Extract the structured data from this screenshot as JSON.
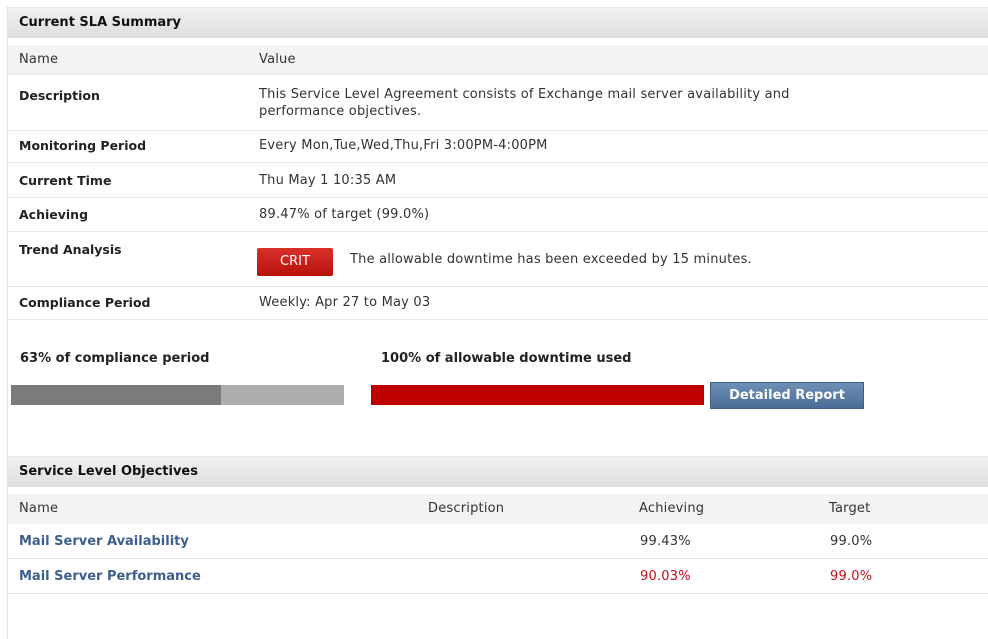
{
  "sla": {
    "title": "Current SLA Summary",
    "col_name": "Name",
    "col_value": "Value",
    "rows": [
      {
        "label": "Description",
        "value": "This Service Level Agreement consists of Exchange mail server availability and",
        "value2": "performance objectives."
      },
      {
        "label": "Monitoring Period",
        "value": "Every Mon,Tue,Wed,Thu,Fri 3:00PM-4:00PM"
      },
      {
        "label": "Current Time",
        "value": "Thu May 1 10:35 AM"
      },
      {
        "label": "Achieving",
        "value": "89.47% of target (99.0%)"
      },
      {
        "label": "Trend Analysis",
        "badge": "CRIT",
        "value": "The allowable downtime has been exceeded by 15 minutes."
      },
      {
        "label": "Compliance Period",
        "value": "Weekly: Apr 27 to May 03"
      }
    ]
  },
  "progress": {
    "compliance": {
      "label": "63% of compliance period",
      "fraction": 0.63
    },
    "downtime": {
      "label": "100% of allowable downtime used",
      "fraction": 1.0
    },
    "detailed_report_button": "Detailed Report"
  },
  "slo": {
    "title": "Service Level Objectives",
    "headers": {
      "name": "Name",
      "description": "Description",
      "achieving": "Achieving",
      "target": "Target"
    },
    "rows": [
      {
        "name": "Mail Server Availability",
        "description": "",
        "achieving": "99.43%",
        "target": "99.0%",
        "status": "ok"
      },
      {
        "name": "Mail Server Performance",
        "description": "",
        "achieving": "90.03%",
        "target": "99.0%",
        "status": "bad"
      }
    ]
  },
  "colors": {
    "link": "#3d5f8e",
    "critical": "#c0111a",
    "crit_badge": "#c81e18",
    "compliance_fill": "#7b7b7b",
    "compliance_track": "#adadad",
    "downtime_fill": "#c00000",
    "button": "#5a7ca5"
  }
}
